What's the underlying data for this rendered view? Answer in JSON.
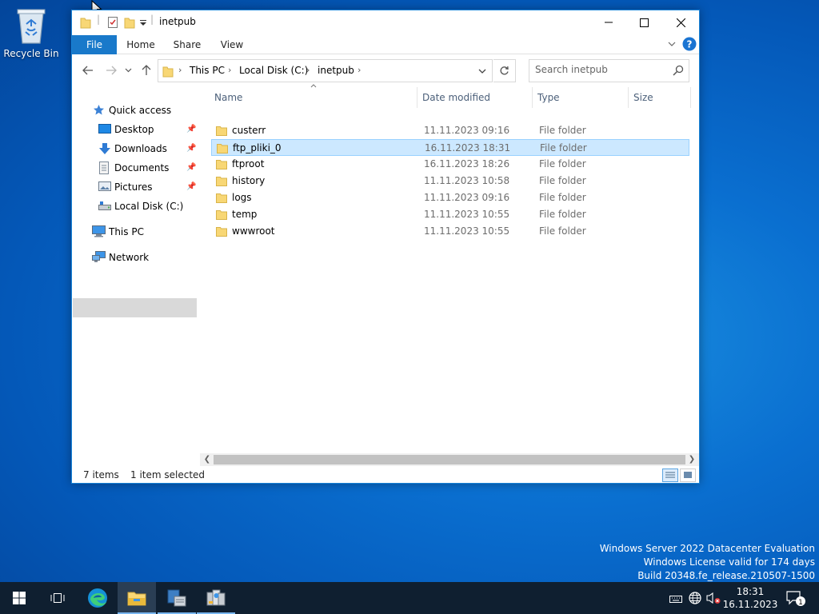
{
  "desktop": {
    "recycle_bin_label": "Recycle Bin"
  },
  "window": {
    "title": "inetpub",
    "ribbon": {
      "tabs": [
        "File",
        "Home",
        "Share",
        "View"
      ]
    },
    "address": {
      "crumbs": [
        "This PC",
        "Local Disk (C:)",
        "inetpub"
      ]
    },
    "search": {
      "placeholder": "Search inetpub"
    },
    "nav": {
      "quick_access": "Quick access",
      "desktop": "Desktop",
      "downloads": "Downloads",
      "documents": "Documents",
      "pictures": "Pictures",
      "local_disk": "Local Disk (C:)",
      "this_pc": "This PC",
      "network": "Network"
    },
    "columns": {
      "name": "Name",
      "date_modified": "Date modified",
      "type": "Type",
      "size": "Size"
    },
    "files": [
      {
        "name": "custerr",
        "date": "11.11.2023 09:16",
        "type": "File folder",
        "selected": false
      },
      {
        "name": "ftp_pliki_0",
        "date": "16.11.2023 18:31",
        "type": "File folder",
        "selected": true
      },
      {
        "name": "ftproot",
        "date": "16.11.2023 18:26",
        "type": "File folder",
        "selected": false
      },
      {
        "name": "history",
        "date": "11.11.2023 10:58",
        "type": "File folder",
        "selected": false
      },
      {
        "name": "logs",
        "date": "11.11.2023 09:16",
        "type": "File folder",
        "selected": false
      },
      {
        "name": "temp",
        "date": "11.11.2023 10:55",
        "type": "File folder",
        "selected": false
      },
      {
        "name": "wwwroot",
        "date": "11.11.2023 10:55",
        "type": "File folder",
        "selected": false
      }
    ],
    "status": {
      "item_count": "7 items",
      "selection": "1 item selected"
    }
  },
  "watermark": {
    "line1": "Windows Server 2022 Datacenter Evaluation",
    "line2": "Windows License valid for 174 days",
    "line3": "Build 20348.fe_release.210507-1500"
  },
  "taskbar": {
    "time": "18:31",
    "date": "16.11.2023",
    "notification_count": "1"
  },
  "colors": {
    "file_tab": "#1979ca",
    "selection_fill": "#cce8ff",
    "selection_border": "#99d1ff",
    "folder_yellow": "#f8d775",
    "taskbar": "#0f1f30"
  }
}
